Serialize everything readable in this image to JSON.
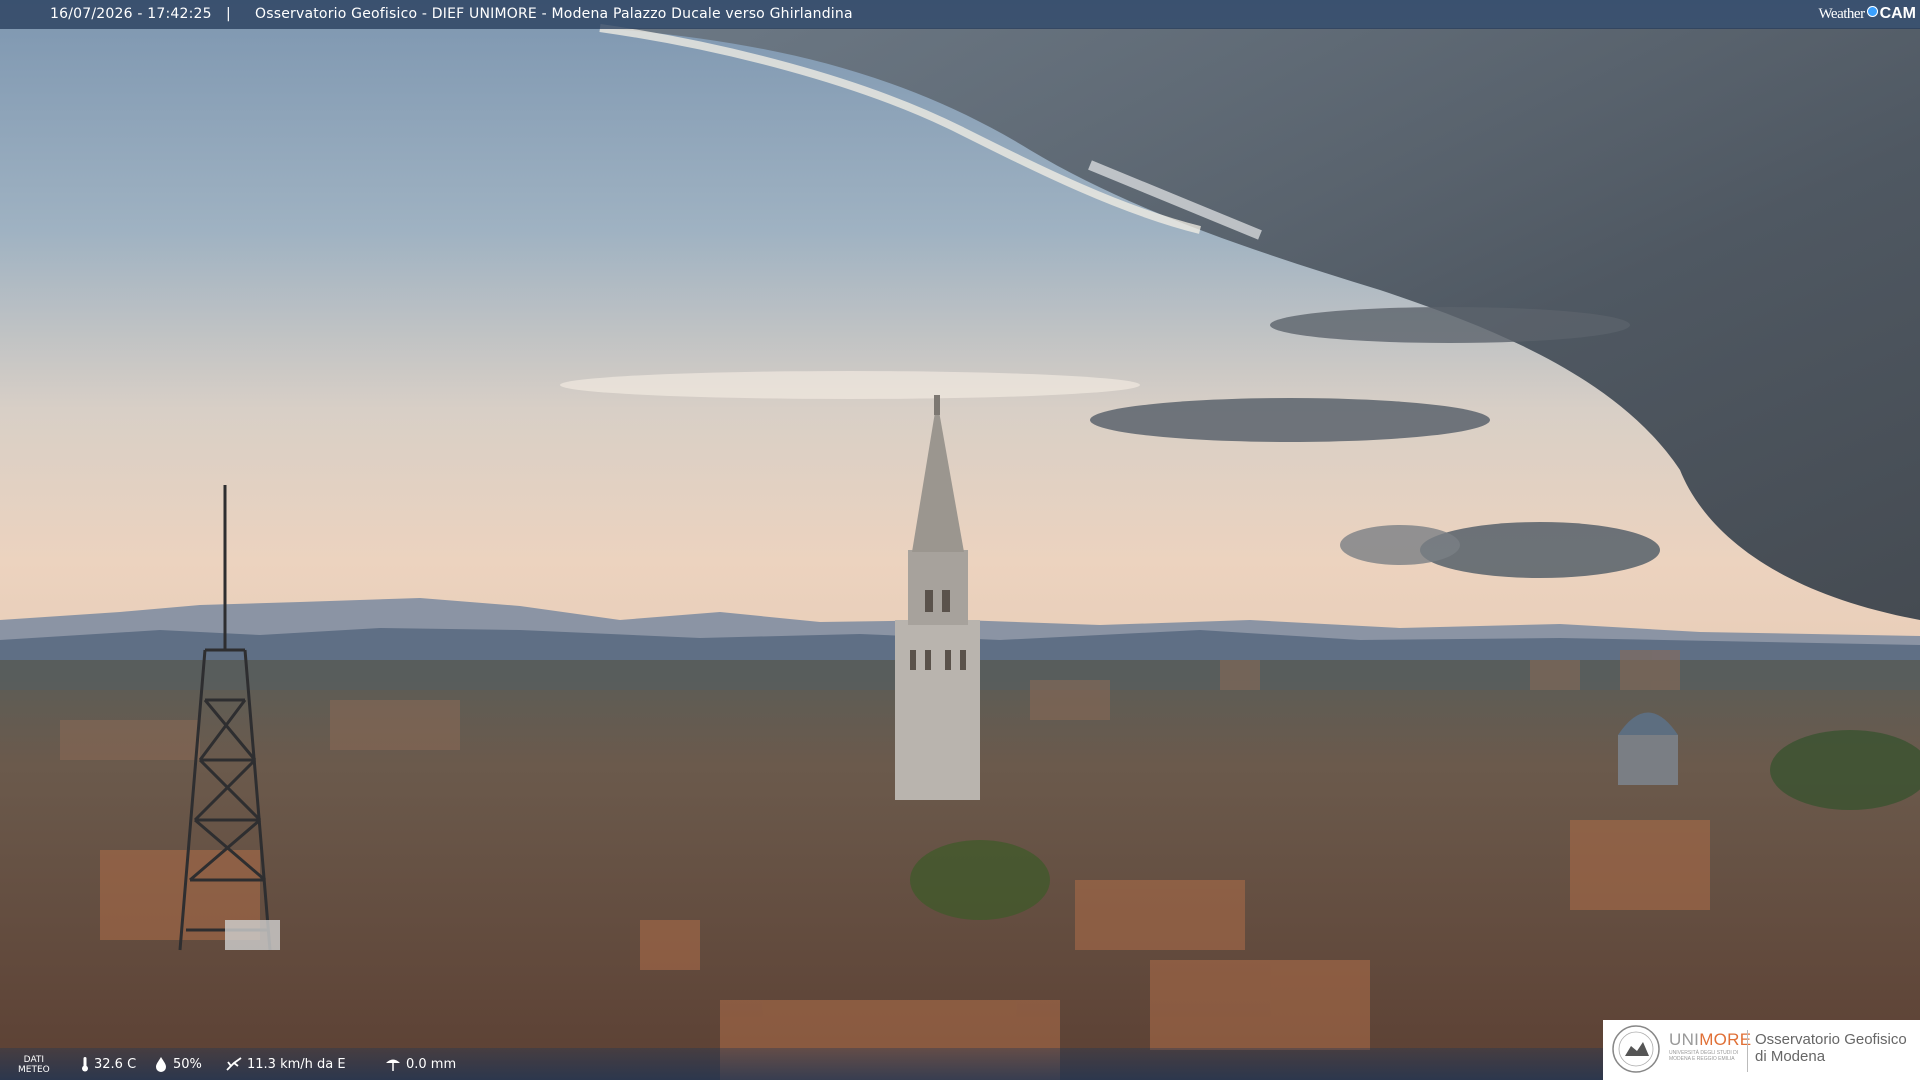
{
  "header": {
    "timestamp": "16/07/2026 - 17:42:25",
    "separator": "|",
    "title": "Osservatorio Geofisico - DIEF UNIMORE - Modena Palazzo Ducale verso Ghirlandina",
    "brand_left": "Weather",
    "brand_right": "CAM"
  },
  "weather": {
    "label_line1": "DATI",
    "label_line2": "METEO",
    "temperature": "32.6 C",
    "humidity": "50%",
    "wind": "11.3 km/h da E",
    "rain": "0.0 mm"
  },
  "logo": {
    "uni_prefix": "UNI",
    "uni_suffix": "MORE",
    "uni_sub": "UNIVERSITÀ DEGLI STUDI DI MODENA E REGGIO EMILIA",
    "org_line1": "Osservatorio Geofisico",
    "org_line2": "di Modena"
  },
  "icons": [
    "thermometer-icon",
    "humidity-icon",
    "wind-icon",
    "rain-gauge-icon",
    "weathercam-logo"
  ]
}
